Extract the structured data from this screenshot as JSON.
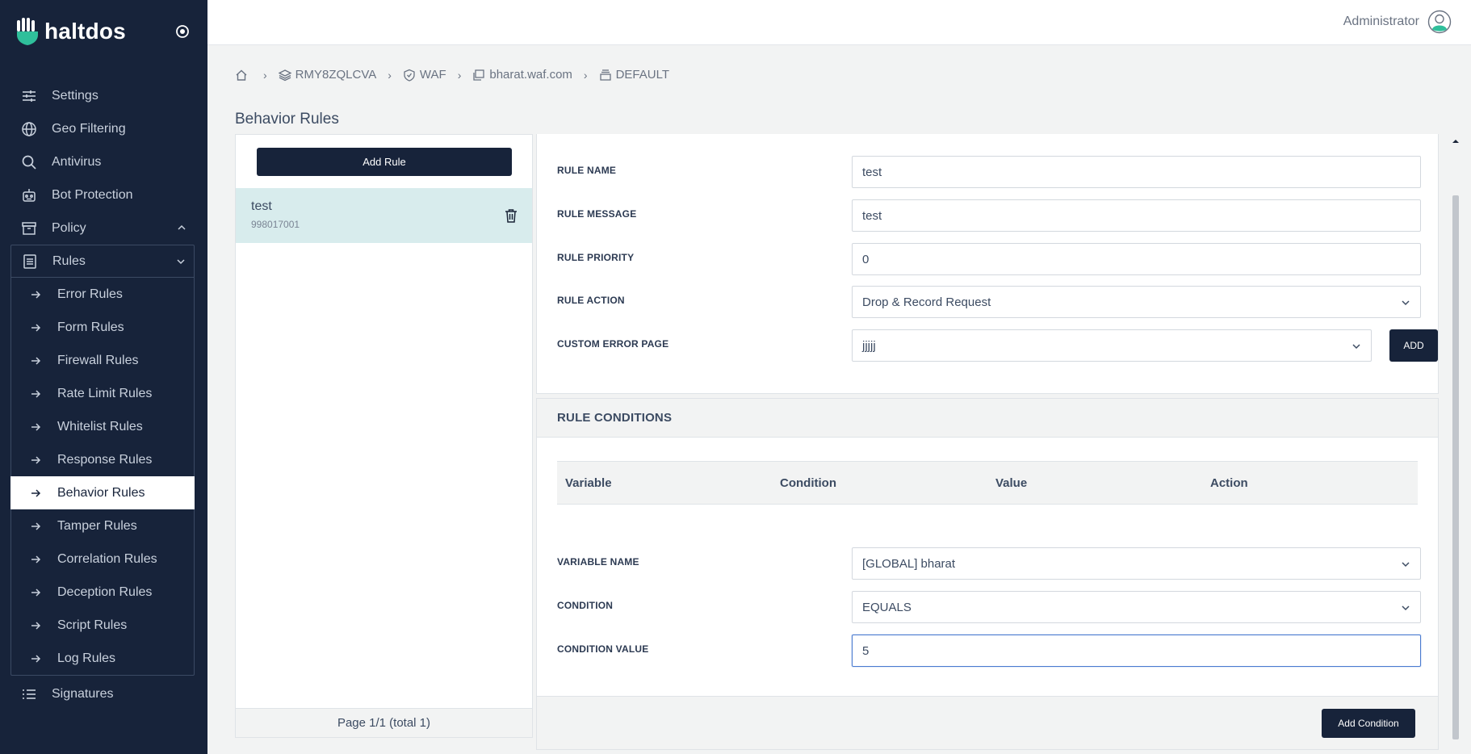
{
  "app": {
    "brand": "haltdos"
  },
  "user": {
    "name": "Administrator"
  },
  "sidebar": {
    "items_top": [
      {
        "label": "Settings",
        "icon": "sliders-icon"
      },
      {
        "label": "Geo Filtering",
        "icon": "globe-icon"
      },
      {
        "label": "Antivirus",
        "icon": "search-icon"
      },
      {
        "label": "Bot Protection",
        "icon": "robot-icon"
      },
      {
        "label": "Policy",
        "icon": "archive-icon"
      }
    ],
    "rules_label": "Rules",
    "rules_items": [
      "Error Rules",
      "Form Rules",
      "Firewall Rules",
      "Rate Limit Rules",
      "Whitelist Rules",
      "Response Rules",
      "Behavior Rules",
      "Tamper Rules",
      "Correlation Rules",
      "Deception Rules",
      "Script Rules",
      "Log Rules"
    ],
    "active_item": "Behavior Rules",
    "signatures_label": "Signatures"
  },
  "breadcrumb": [
    "RMY8ZQLCVA",
    "WAF",
    "bharat.waf.com",
    "DEFAULT"
  ],
  "page_title": "Behavior Rules",
  "rule_list": {
    "add_button": "Add Rule",
    "rules": [
      {
        "name": "test",
        "id": "998017001"
      }
    ],
    "pagination": "Page 1/1 (total 1)"
  },
  "form": {
    "rule_name_label": "RULE NAME",
    "rule_name_value": "test",
    "rule_message_label": "RULE MESSAGE",
    "rule_message_value": "test",
    "rule_priority_label": "RULE PRIORITY",
    "rule_priority_value": "0",
    "rule_action_label": "RULE ACTION",
    "rule_action_value": "Drop & Record Request",
    "custom_error_label": "CUSTOM ERROR PAGE",
    "custom_error_value": "jjjjj",
    "add_label": "ADD"
  },
  "conditions": {
    "title": "RULE CONDITIONS",
    "columns": [
      "Variable",
      "Condition",
      "Value",
      "Action"
    ],
    "variable_name_label": "VARIABLE NAME",
    "variable_name_value": "[GLOBAL] bharat",
    "condition_label": "CONDITION",
    "condition_value": "EQUALS",
    "condition_value_label": "CONDITION VALUE",
    "condition_value_value": "5",
    "add_condition_label": "Add Condition"
  },
  "colors": {
    "sidebar_bg": "#17233a",
    "active_row": "#d8eced",
    "focus_border": "#4a7bd0"
  }
}
